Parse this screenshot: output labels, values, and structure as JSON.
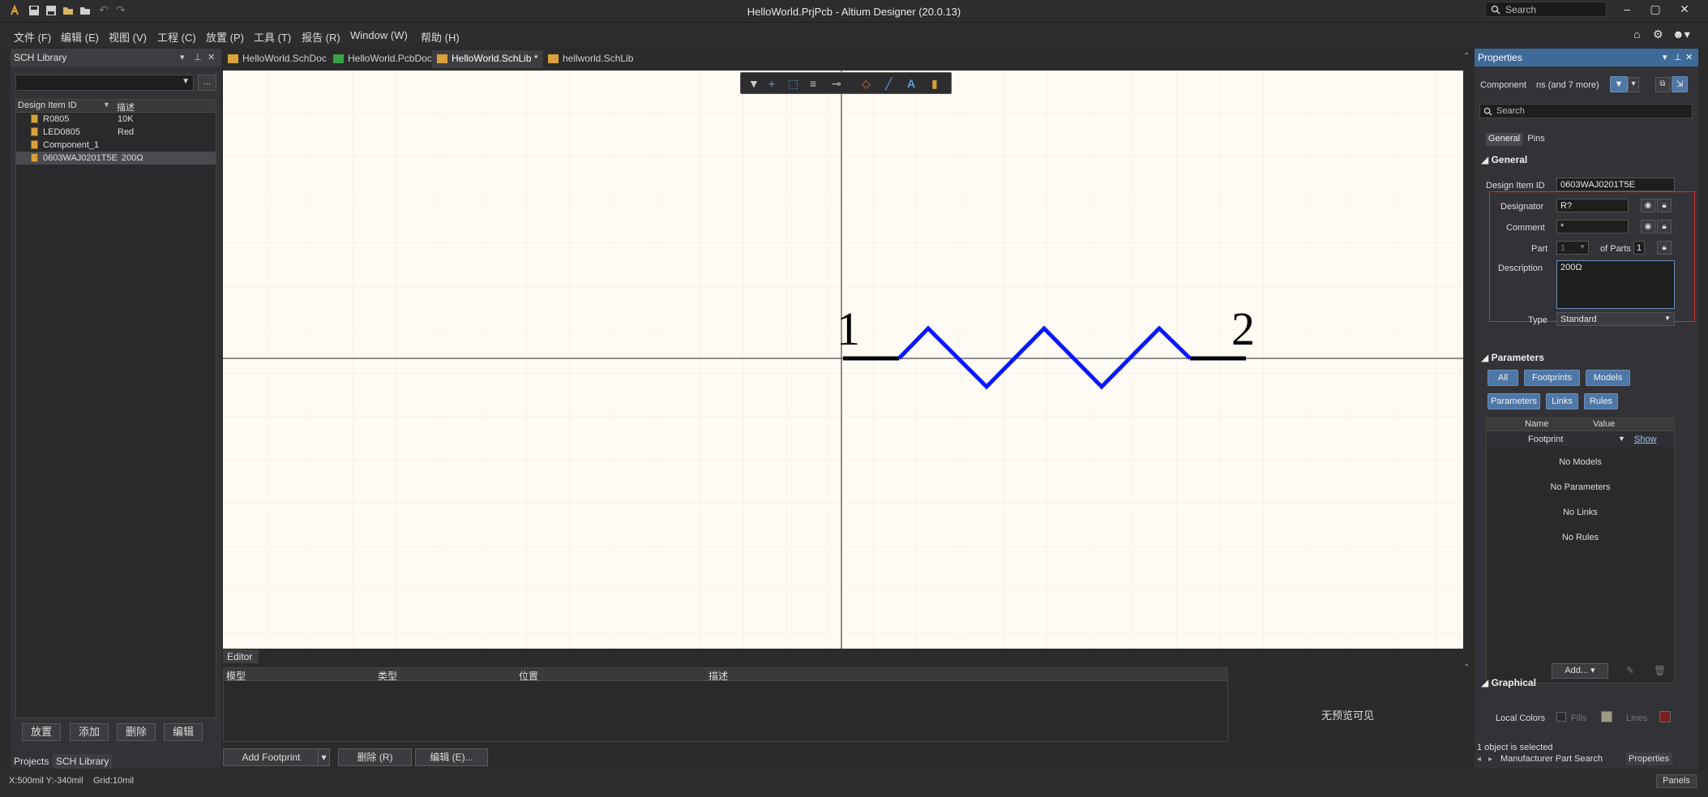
{
  "window": {
    "title": "HelloWorld.PrjPcb - Altium Designer (20.0.13)",
    "search_placeholder": "Search"
  },
  "menu": [
    "文件 (F)",
    "编辑 (E)",
    "视图 (V)",
    "工程 (C)",
    "放置 (P)",
    "工具 (T)",
    "报告 (R)",
    "Window (W)",
    "帮助 (H)"
  ],
  "left_panel": {
    "title": "SCH Library",
    "columns": [
      "Design Item ID",
      "描述"
    ],
    "rows": [
      {
        "id": "R0805",
        "desc": "10K"
      },
      {
        "id": "LED0805",
        "desc": "Red"
      },
      {
        "id": "Component_1",
        "desc": ""
      },
      {
        "id": "0603WAJ0201T5E",
        "desc": "200Ω"
      }
    ],
    "buttons": [
      "放置",
      "添加",
      "删除",
      "编辑"
    ],
    "tabs": [
      "Projects",
      "SCH Library"
    ]
  },
  "doc_tabs": [
    {
      "label": "HelloWorld.SchDoc",
      "color": "#d8a13a"
    },
    {
      "label": "HelloWorld.PcbDoc",
      "color": "#3aa04a"
    },
    {
      "label": "HelloWorld.SchLib *",
      "color": "#d8a13a"
    },
    {
      "label": "hellworld.SchLib",
      "color": "#d8a13a"
    }
  ],
  "canvas": {
    "pin1_label": "1",
    "pin2_label": "2",
    "colors": {
      "body": "#0a18ff",
      "pin": "#000000",
      "background": "#fdfbf3"
    }
  },
  "editor": {
    "tab": "Editor",
    "columns": [
      "模型",
      "类型",
      "位置",
      "描述"
    ],
    "no_preview": "无预览可见",
    "buttons": {
      "add_footprint": "Add Footprint",
      "delete": "删除 (R)",
      "edit": "编辑 (E)..."
    }
  },
  "properties": {
    "title": "Properties",
    "component_label": "Component",
    "component_filter": "ns (and 7 more)",
    "search_placeholder": "Search",
    "tabs": [
      "General",
      "Pins"
    ],
    "general_header": "General",
    "fields": {
      "design_item_id_label": "Design Item ID",
      "design_item_id": "0603WAJ0201T5E",
      "designator_label": "Designator",
      "designator": "R?",
      "comment_label": "Comment",
      "comment": "*",
      "part_label": "Part",
      "part": "1",
      "of_parts_label": "of Parts",
      "of_parts": "1",
      "description_label": "Description",
      "description": "200Ω",
      "type_label": "Type",
      "type": "Standard"
    },
    "parameters_header": "Parameters",
    "filter_chips": [
      "All",
      "Footprints",
      "Models",
      "Parameters",
      "Links",
      "Rules"
    ],
    "param_columns": [
      "Name",
      "Value"
    ],
    "param_row": {
      "name": "Footprint",
      "value": "Show"
    },
    "messages": [
      "No Models",
      "No Parameters",
      "No Links",
      "No Rules"
    ],
    "add_button": "Add...",
    "graphical_header": "Graphical",
    "local_colors_label": "Local Colors",
    "fills_label": "Fills",
    "lines_label": "Lines",
    "selection_status": "1 object is selected",
    "bottom_tabs": [
      "Manufacturer Part Search",
      "Properties"
    ]
  },
  "status": {
    "coords": "X:500mil Y:-340mil",
    "grid": "Grid:10mil",
    "panels": "Panels"
  }
}
